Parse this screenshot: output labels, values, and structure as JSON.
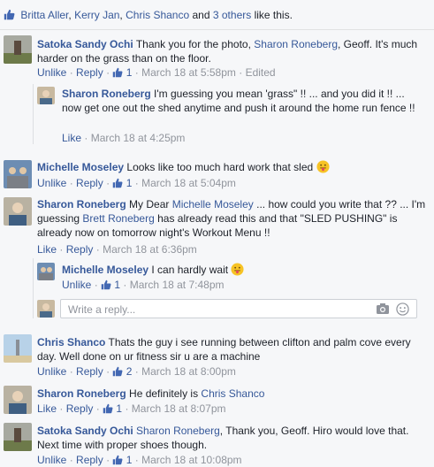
{
  "likes_bar": {
    "name1": "Britta Aller",
    "name2": "Kerry Jan",
    "name3": "Chris Shanco",
    "and": "and",
    "others": "3 others",
    "suffix": "like this.",
    "sep": ","
  },
  "actions": {
    "like": "Like",
    "unlike": "Unlike",
    "reply": "Reply",
    "dot": "·"
  },
  "comments": [
    {
      "author": "Satoka Sandy Ochi",
      "text_before": "Thank you for the photo,",
      "mention": "Sharon Roneberg",
      "text_after": ", Geoff. It's much harder on the grass than on the floor.",
      "action": "Unlike",
      "likes": "1",
      "time": "March 18 at 5:58pm",
      "edited": "Edited"
    },
    {
      "author": "Sharon Roneberg",
      "text": "I'm guessing you mean 'grass\" !! ... and you did it !! ... now get one out the shed anytime and push it around the home run fence !!",
      "action": "Like",
      "time": "March 18 at 4:25pm"
    },
    {
      "author": "Michelle Moseley",
      "text": "Looks like too much hard work that sled",
      "emoji": "tongue-out-emoji",
      "action": "Unlike",
      "likes": "1",
      "time": "March 18 at 5:04pm"
    },
    {
      "author": "Sharon Roneberg",
      "text_before": "My Dear",
      "mention1": "Michelle Moseley",
      "text_mid": "... how could you write that ?? ... I'm guessing",
      "mention2": "Brett Roneberg",
      "text_after": "has already read this and that \"SLED PUSHING\" is already now on tomorrow night's Workout Menu !!",
      "action": "Like",
      "time": "March 18 at 6:36pm"
    },
    {
      "author": "Michelle Moseley",
      "text": "I can hardly wait",
      "emoji": "tongue-out-emoji",
      "action": "Unlike",
      "likes": "1",
      "time": "March 18 at 7:48pm"
    },
    {
      "author": "Chris Shanco",
      "text": "Thats the guy i see running between clifton and palm cove every day. Well done on ur fitness sir u are a machine",
      "action": "Unlike",
      "likes": "2",
      "time": "March 18 at 8:00pm"
    },
    {
      "author": "Sharon Roneberg",
      "text": "He definitely is",
      "mention": "Chris Shanco",
      "action": "Reply",
      "likes": "1",
      "time": "March 18 at 8:07pm"
    },
    {
      "author": "Satoka Sandy Ochi",
      "mention": "Sharon Roneberg",
      "text_after": ", Thank you, Geoff. Hiro would love that. Next time with proper shoes though.",
      "action": "Unlike",
      "likes": "1",
      "time": "March 18 at 10:08pm"
    }
  ],
  "reply_box": {
    "placeholder": "Write a reply..."
  },
  "icons": {
    "camera": "camera-icon",
    "emoji": "smiley-icon",
    "like": "thumbs-up-icon"
  },
  "colors": {
    "link": "#365899",
    "meta": "#90949c",
    "background": "#f6f7f9"
  }
}
